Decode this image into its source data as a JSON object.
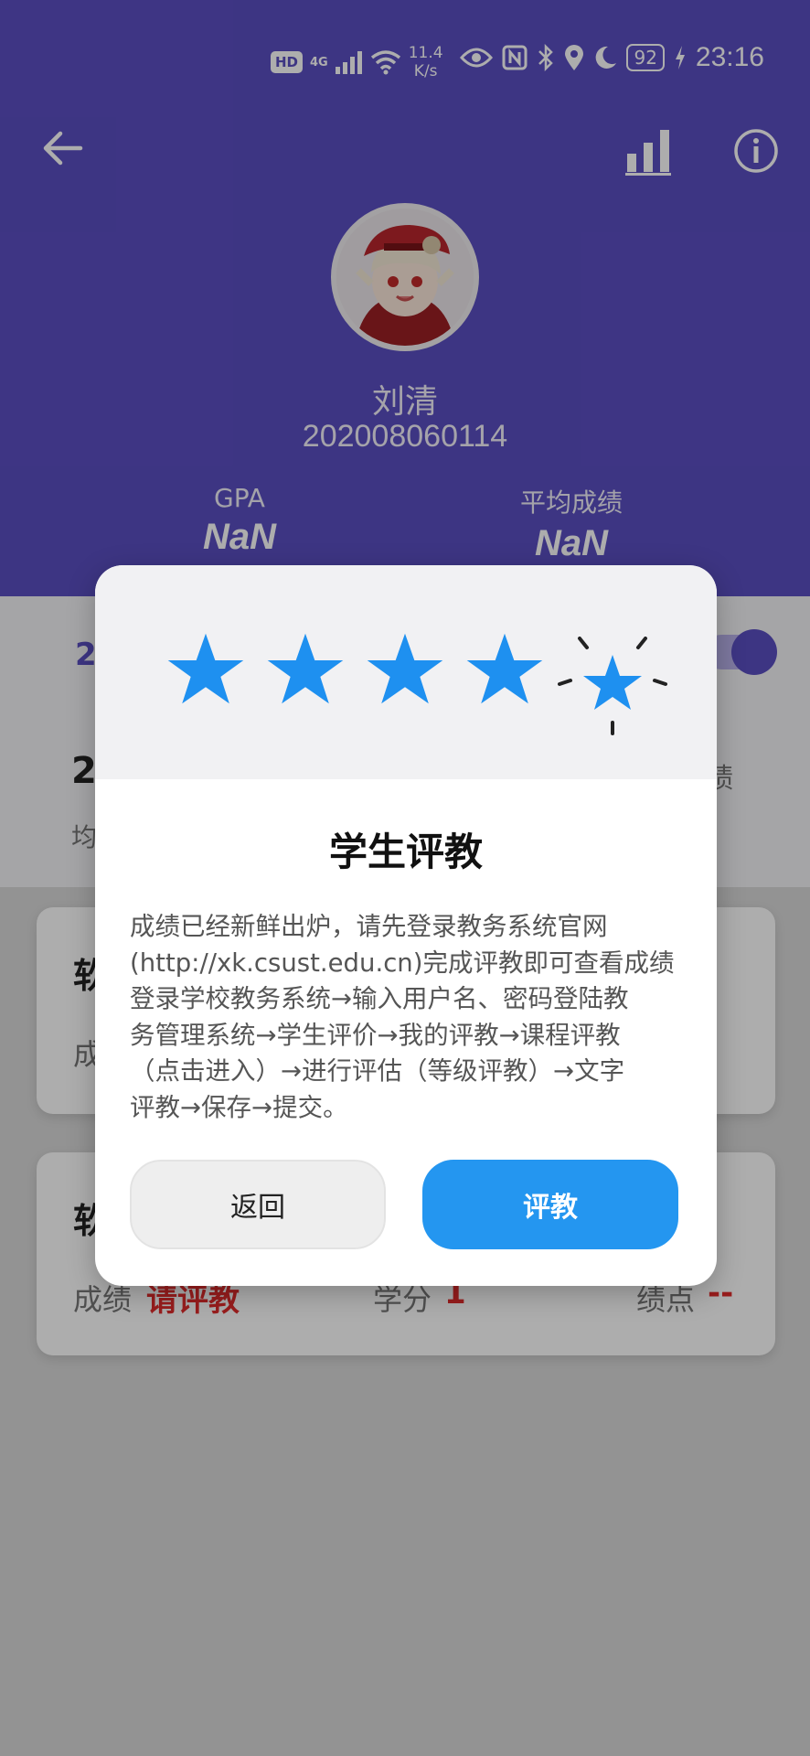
{
  "status_bar": {
    "hd": "HD",
    "network": "4G",
    "speed_value": "11.4",
    "speed_unit": "K/s",
    "battery": "92",
    "time": "23:16"
  },
  "profile": {
    "name": "刘清",
    "student_id": "202008060114",
    "gpa_label": "GPA",
    "gpa_value": "NaN",
    "avg_label": "平均成绩",
    "avg_value": "NaN"
  },
  "summary": {
    "semester_prefix": "2",
    "big_prefix": "2",
    "sub_prefix": "均",
    "right_suffix": "绩"
  },
  "courses": [
    {
      "title_prefix": "软",
      "score_label_prefix": "成"
    },
    {
      "title_prefix": "软",
      "score_label": "成绩",
      "score_value": "请评教",
      "credit_label": "学分",
      "credit_value": "1",
      "gp_label": "绩点",
      "gp_value": "--"
    }
  ],
  "dialog": {
    "rating": 5,
    "title": "学生评教",
    "body_lines": [
      "成绩已经新鲜出炉，请先登录教务系统官网",
      "(http://xk.csust.edu.cn)完成评教即可查看成绩",
      "登录学校教务系统→输入用户名、密码登陆教",
      "务管理系统→学生评价→我的评教→课程评教",
      "（点击进入）→进行评估（等级评教）→文字",
      "评教→保存→提交。"
    ],
    "back_label": "返回",
    "evaluate_label": "评教"
  },
  "colors": {
    "header": "#5b4ec2",
    "star": "#1e90f0",
    "primary_button": "#2496f0",
    "danger_text": "#e02b2b"
  }
}
